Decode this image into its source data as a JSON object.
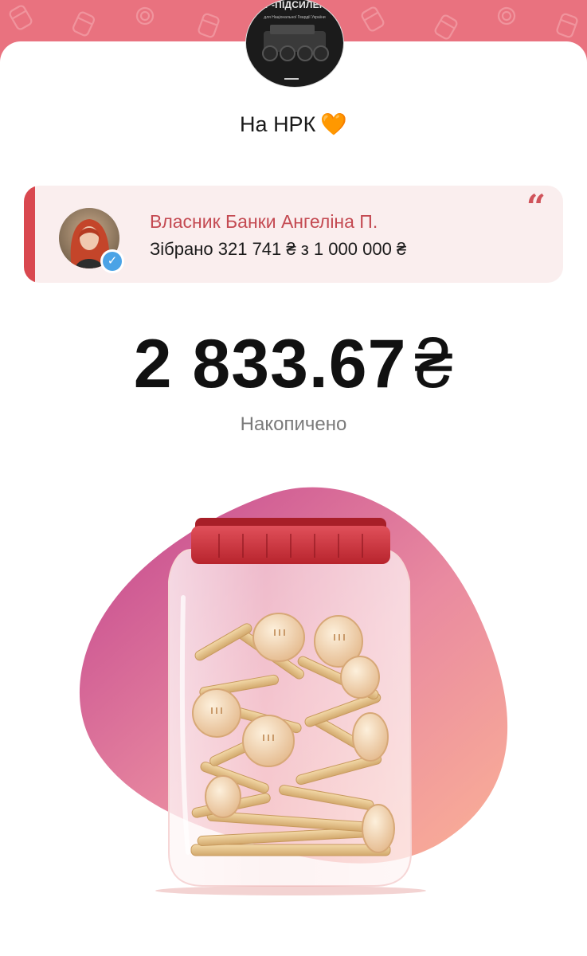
{
  "jar": {
    "cover_title": "ЗБІР-ПІДСИЛЕННЯ",
    "cover_subtitle": "для Національної Гвардії України",
    "title": "На НРК",
    "title_emoji": "🧡"
  },
  "owner": {
    "name": "Власник Банки Ангеліна П.",
    "progress_text": "Зібрано 321 741 ₴ з 1 000 000 ₴",
    "collected": 321741,
    "goal": 1000000,
    "quote_icon": "quote-icon",
    "verified_icon": "check-icon"
  },
  "balance": {
    "amount": "2 833.67",
    "currency": "₴",
    "label": "Накопичено"
  },
  "colors": {
    "brand_pink": "#e9727f",
    "accent_red": "#d9484f",
    "name_red": "#c44a52",
    "card_bg": "#faeeee"
  }
}
